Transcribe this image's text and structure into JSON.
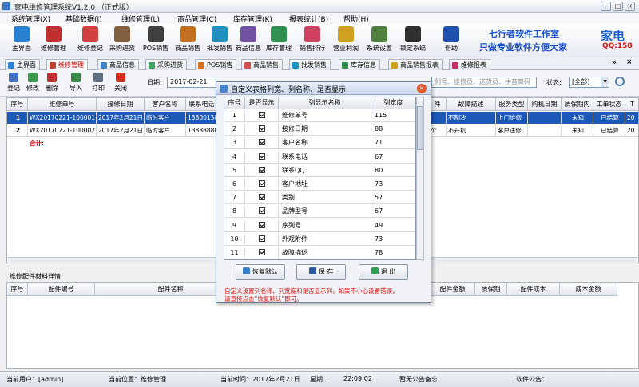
{
  "window": {
    "title": "家电维修管理系统V1.2.0 （正式版）"
  },
  "menubar": [
    "系统管理(X)",
    "基础数据(J)",
    "维修管理(L)",
    "商品管理(C)",
    "库存管理(K)",
    "报表统计(B)",
    "帮助(H)"
  ],
  "toolbar": [
    {
      "label": "主界面",
      "icon": "home-icon",
      "color": "#2a80d0"
    },
    {
      "label": "维修管理",
      "icon": "check-form-icon",
      "color": "#c03030"
    },
    {
      "label": "维修登记",
      "icon": "pen-form-icon",
      "color": "#d04040"
    },
    {
      "label": "采购进货",
      "icon": "clipboard-icon",
      "color": "#806040"
    },
    {
      "label": "POS销售",
      "icon": "pos-icon",
      "color": "#404040"
    },
    {
      "label": "商品销售",
      "icon": "sale-icon",
      "color": "#c07020"
    },
    {
      "label": "批发销售",
      "icon": "wholesale-icon",
      "color": "#2090c0"
    },
    {
      "label": "商品信息",
      "icon": "product-icon",
      "color": "#7050a0"
    },
    {
      "label": "库存管理",
      "icon": "stock-icon",
      "color": "#309050"
    },
    {
      "label": "销售排行",
      "icon": "bar-chart-icon",
      "color": "#d04060"
    },
    {
      "label": "营业利润",
      "icon": "profit-icon",
      "color": "#d0a020"
    },
    {
      "label": "系统设置",
      "icon": "settings-icon",
      "color": "#508040"
    },
    {
      "label": "锁定系统",
      "icon": "lock-icon",
      "color": "#303030"
    },
    {
      "label": "帮助",
      "icon": "help-icon",
      "color": "#2050b0"
    }
  ],
  "promo": {
    "line1": "七行者软件工作室",
    "line2": "只做专业软件方便大家",
    "brand": "家电",
    "qq": "QQ:158"
  },
  "tabs": [
    {
      "label": "主界面",
      "active": false
    },
    {
      "label": "维修管理",
      "active": true
    },
    {
      "label": "商品信息",
      "active": false
    },
    {
      "label": "采购进货",
      "active": false
    },
    {
      "label": "POS销售",
      "active": false
    },
    {
      "label": "商品销售",
      "active": false
    },
    {
      "label": "批发销售",
      "active": false
    },
    {
      "label": "库存信息",
      "active": false
    },
    {
      "label": "商品销售报表",
      "active": false
    },
    {
      "label": "维修报表",
      "active": false
    }
  ],
  "subbar": {
    "buttons": [
      "登记",
      "修改",
      "删除",
      "导入",
      "打印",
      "关闭"
    ],
    "date_label": "日期:",
    "date_value": "2017-02-21",
    "search_placeholder": "列号、维修员、送货员、拼音简码",
    "status_label": "状态:",
    "status_value": "[全部]"
  },
  "grid": {
    "columns_left": [
      "序号",
      "维修单号",
      "接修日期",
      "客户名称",
      "联系电话"
    ],
    "columns_right": [
      "件",
      "故障描述",
      "服务类型",
      "购机日期",
      "质保期内",
      "工单状态",
      "T"
    ],
    "rows": [
      {
        "no": "1",
        "order": "WX20170221-100001",
        "date": "2017年2月21日",
        "customer": "临时客户",
        "phone": "13800138",
        "r0": "",
        "fault": "不制冷",
        "service": "上门维修",
        "buy": "",
        "warranty": "未知",
        "state": "已结算",
        "t": "20"
      },
      {
        "no": "2",
        "order": "WX20170221-100002",
        "date": "2017年2月21日",
        "customer": "临时客户",
        "phone": "13888888",
        "r0": "个",
        "fault": "不开机",
        "service": "客户送修",
        "buy": "",
        "warranty": "未知",
        "state": "已结算",
        "t": "20"
      }
    ],
    "total_label": "合计:"
  },
  "detail": {
    "title": "维修配件材料详情",
    "columns_left": [
      "序号",
      "配件编号",
      "配件名称"
    ],
    "columns_right": [
      "配件金额",
      "质保期",
      "配件成本",
      "成本金额"
    ]
  },
  "dialog": {
    "title": "自定义表格列宽、列名称、是否显示",
    "columns": [
      "序号",
      "是否显示",
      "列显示名称",
      "列宽度"
    ],
    "rows": [
      {
        "no": "1",
        "name": "维修单号",
        "width": "115"
      },
      {
        "no": "2",
        "name": "接修日期",
        "width": "88"
      },
      {
        "no": "3",
        "name": "客户名称",
        "width": "71"
      },
      {
        "no": "4",
        "name": "联系电话",
        "width": "67"
      },
      {
        "no": "5",
        "name": "联系QQ",
        "width": "80"
      },
      {
        "no": "6",
        "name": "客户地址",
        "width": "73"
      },
      {
        "no": "7",
        "name": "类别",
        "width": "57"
      },
      {
        "no": "8",
        "name": "品牌型号",
        "width": "67"
      },
      {
        "no": "9",
        "name": "序列号",
        "width": "49"
      },
      {
        "no": "10",
        "name": "外观附件",
        "width": "73"
      },
      {
        "no": "11",
        "name": "故障描述",
        "width": "78"
      }
    ],
    "buttons": {
      "restore": "恢复默认",
      "save": "保 存",
      "exit": "退 出"
    },
    "note1": "自定义设置列名称、列宽度和是否显示列，如果不小心设置错误，",
    "note2": "请直接点击“恢复默认”即可。"
  },
  "statusbar": {
    "user": "当前用户：[admin]",
    "location": "当前位置：维修管理",
    "time": "当前时间：2017年2月21日",
    "weekday": "星期二",
    "clock": "22:09:02",
    "notice": "暂无公告备忘",
    "software_notice": "软件公告："
  }
}
